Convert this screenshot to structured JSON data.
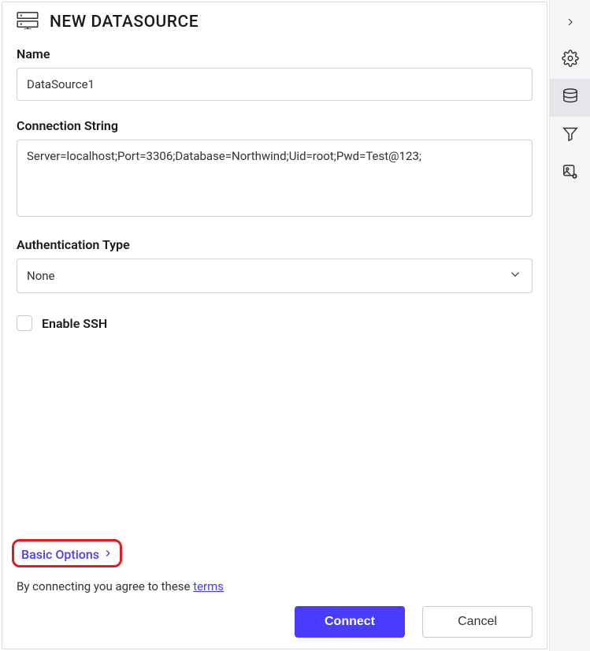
{
  "header": {
    "title": "NEW DATASOURCE"
  },
  "fields": {
    "name": {
      "label": "Name",
      "value": "DataSource1"
    },
    "connection_string": {
      "label": "Connection String",
      "value": "Server=localhost;Port=3306;Database=Northwind;Uid=root;Pwd=Test@123;"
    },
    "auth_type": {
      "label": "Authentication Type",
      "value": "None"
    },
    "enable_ssh": {
      "label": "Enable SSH",
      "checked": false
    }
  },
  "basic_options_label": "Basic Options",
  "terms": {
    "prefix": "By connecting you agree to these ",
    "link": "terms"
  },
  "buttons": {
    "connect": "Connect",
    "cancel": "Cancel"
  },
  "side_rail": {
    "collapse": "collapse-icon",
    "items": [
      {
        "name": "settings-icon",
        "active": false
      },
      {
        "name": "database-icon",
        "active": true
      },
      {
        "name": "filter-icon",
        "active": false
      },
      {
        "name": "image-settings-icon",
        "active": false
      }
    ]
  }
}
